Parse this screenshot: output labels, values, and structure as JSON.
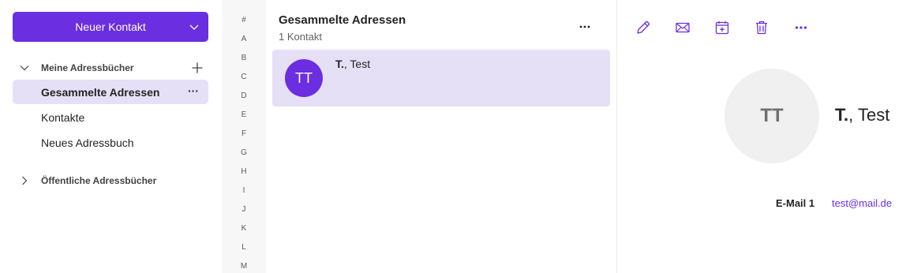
{
  "sidebar": {
    "new_contact_label": "Neuer Kontakt",
    "my_books_label": "Meine Adressbücher",
    "items": [
      {
        "label": "Gesammelte Adressen",
        "more": "···"
      },
      {
        "label": "Kontakte"
      },
      {
        "label": "Neues Adressbuch"
      }
    ],
    "public_books_label": "Öffentliche Adressbücher"
  },
  "alphabet": [
    "#",
    "A",
    "B",
    "C",
    "D",
    "E",
    "F",
    "G",
    "H",
    "I",
    "J",
    "K",
    "L",
    "M"
  ],
  "list": {
    "title": "Gesammelte Adressen",
    "subtitle": "1 Kontakt",
    "contacts": [
      {
        "initials": "TT",
        "last_name": "T.",
        "rest_name": ", Test"
      }
    ]
  },
  "detail": {
    "initials": "TT",
    "last_name": "T.",
    "rest_name": ", Test",
    "email_label": "E-Mail 1",
    "email_value": "test@mail.de"
  },
  "colors": {
    "accent": "#6b2ee0",
    "selected_bg": "#e6e0f7",
    "alphabet_bg": "#f7f7f7"
  },
  "icons": {
    "toolbar": [
      "edit-icon",
      "mail-icon",
      "calendar-add-icon",
      "delete-icon",
      "more-icon"
    ]
  }
}
